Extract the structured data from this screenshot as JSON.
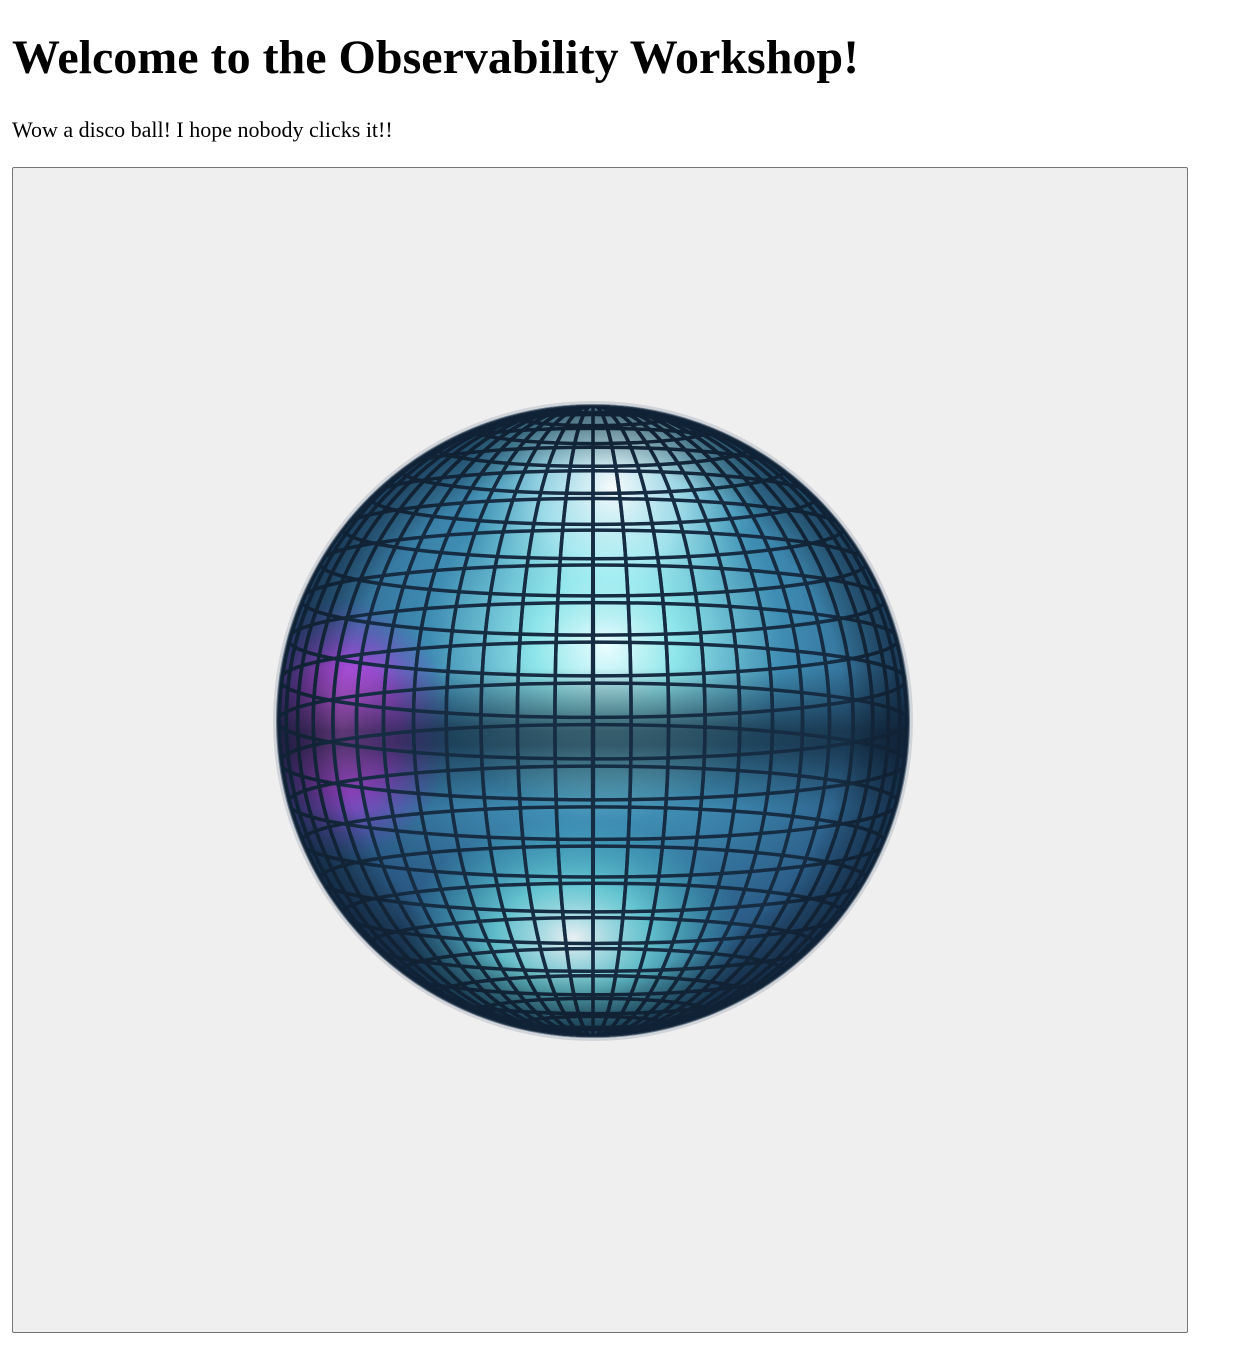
{
  "page": {
    "title": "Welcome to the Observability Workshop!",
    "intro": "Wow a disco ball! I hope nobody clicks it!!"
  },
  "disco_button": {
    "image": "disco-ball-icon"
  },
  "colors": {
    "button_background": "#efefef",
    "button_border": "#767676",
    "ball_dark": "#1c3550",
    "ball_mid": "#3c84a8",
    "ball_highlight": "#e6fdff",
    "ball_cyan": "#5fe6e6",
    "ball_magenta": "#d845f0"
  }
}
